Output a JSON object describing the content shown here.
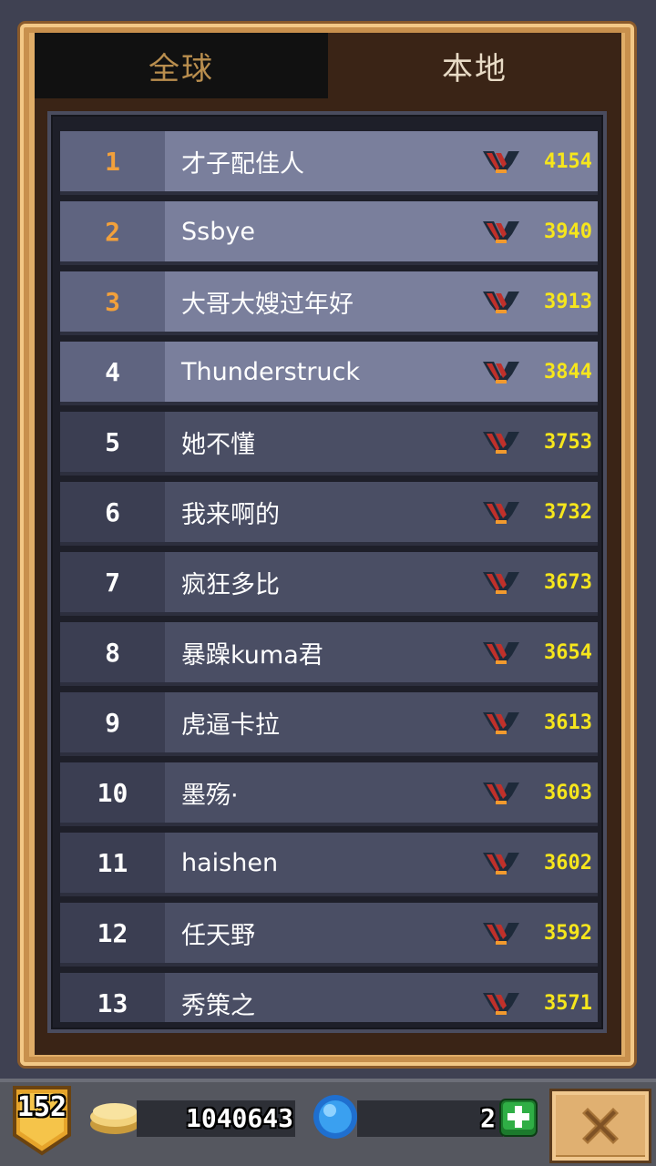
{
  "tabs": {
    "global": "全球",
    "local": "本地"
  },
  "leaderboard": [
    {
      "rank": "1",
      "name": "才子配佳人",
      "score": "4154"
    },
    {
      "rank": "2",
      "name": "Ssbye",
      "score": "3940"
    },
    {
      "rank": "3",
      "name": "大哥大嫂过年好",
      "score": "3913"
    },
    {
      "rank": "4",
      "name": "Thunderstruck",
      "score": "3844"
    },
    {
      "rank": "5",
      "name": "她不懂",
      "score": "3753"
    },
    {
      "rank": "6",
      "name": "我来啊的",
      "score": "3732"
    },
    {
      "rank": "7",
      "name": "疯狂多比",
      "score": "3673"
    },
    {
      "rank": "8",
      "name": "暴躁kuma君",
      "score": "3654"
    },
    {
      "rank": "9",
      "name": "虎逼卡拉",
      "score": "3613"
    },
    {
      "rank": "10",
      "name": "墨殇·",
      "score": "3603"
    },
    {
      "rank": "11",
      "name": "haishen",
      "score": "3602"
    },
    {
      "rank": "12",
      "name": "任天野",
      "score": "3592"
    },
    {
      "rank": "13",
      "name": "秀策之",
      "score": "3571"
    }
  ],
  "footer": {
    "level": "152",
    "coins": "1040643",
    "gems": "2"
  },
  "colors": {
    "score": "#f6e61c",
    "top_rank": "#f2a03b",
    "emblem_red": "#c0302a",
    "emblem_dark": "#1e2a3a"
  }
}
